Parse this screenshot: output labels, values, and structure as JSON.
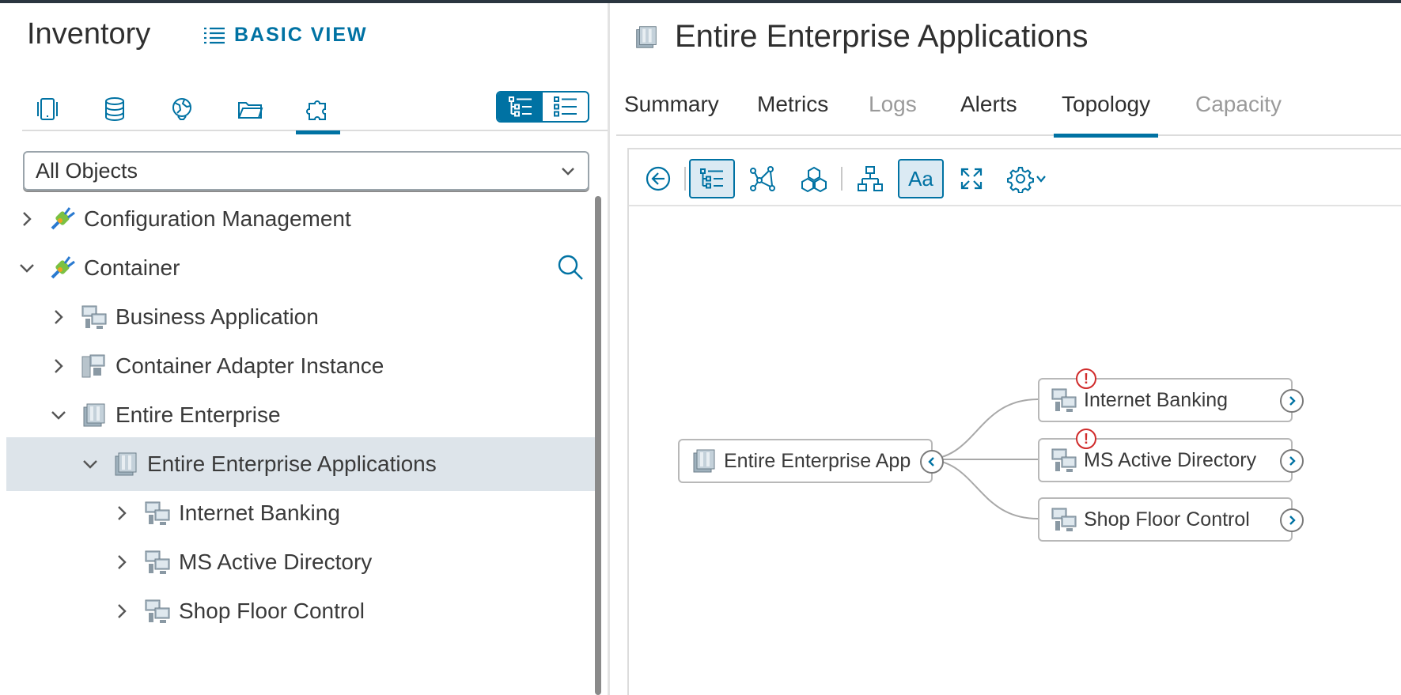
{
  "inventory": {
    "title": "Inventory",
    "basic_view_label": "BASIC VIEW",
    "icon_tabs": [
      "hosts-icon",
      "datastore-icon",
      "network-icon",
      "folder-icon",
      "puzzle-icon"
    ],
    "active_icon_tab": "puzzle-icon",
    "filter": {
      "selected": "All Objects"
    },
    "tree": [
      {
        "label": "Configuration Management",
        "level": 0,
        "expanded": false,
        "icon": "adapter-plug-icon"
      },
      {
        "label": "Container",
        "level": 0,
        "expanded": true,
        "icon": "adapter-plug-icon"
      },
      {
        "label": "Business Application",
        "level": 1,
        "expanded": false,
        "icon": "application-icon"
      },
      {
        "label": "Container Adapter Instance",
        "level": 1,
        "expanded": false,
        "icon": "adapter-instance-icon"
      },
      {
        "label": "Entire Enterprise",
        "level": 1,
        "expanded": true,
        "icon": "enterprise-icon"
      },
      {
        "label": "Entire Enterprise Applications",
        "level": 2,
        "expanded": true,
        "selected": true,
        "icon": "enterprise-icon"
      },
      {
        "label": "Internet Banking",
        "level": 3,
        "expanded": false,
        "icon": "application-icon"
      },
      {
        "label": "MS Active Directory",
        "level": 3,
        "expanded": false,
        "icon": "application-icon"
      },
      {
        "label": "Shop Floor Control",
        "level": 3,
        "expanded": false,
        "icon": "application-icon"
      }
    ]
  },
  "object": {
    "title": "Entire Enterprise Applications",
    "tabs": [
      {
        "label": "Summary",
        "state": "normal"
      },
      {
        "label": "Metrics",
        "state": "normal"
      },
      {
        "label": "Logs",
        "state": "disabled"
      },
      {
        "label": "Alerts",
        "state": "normal"
      },
      {
        "label": "Topology",
        "state": "active"
      },
      {
        "label": "Capacity",
        "state": "disabled"
      }
    ]
  },
  "topology": {
    "toolbar": {
      "text_toggle_label": "Aa"
    },
    "root_node": {
      "label": "Entire Enterprise Applications",
      "visible_label": "Entire Enterprise App"
    },
    "child_nodes": [
      {
        "label": "Internet Banking",
        "alert": true
      },
      {
        "label": "MS Active Directory",
        "alert": true
      },
      {
        "label": "Shop Floor Control",
        "alert": false
      }
    ],
    "alert_glyph": "!"
  },
  "colors": {
    "accent": "#0072a3",
    "selected_row": "#dde4ea",
    "alert": "#d02b2b"
  }
}
